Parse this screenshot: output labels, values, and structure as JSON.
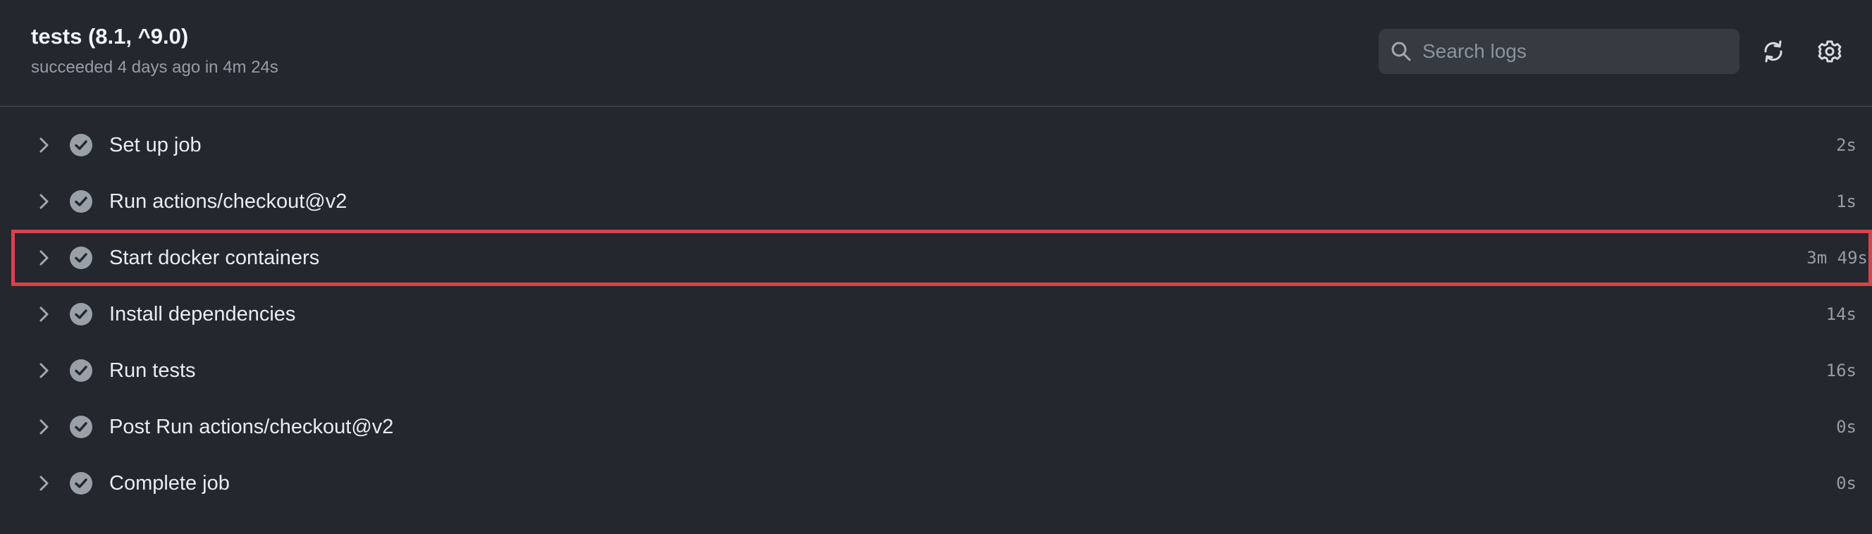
{
  "header": {
    "title": "tests (8.1, ^9.0)",
    "subtitle": "succeeded 4 days ago in 4m 24s",
    "search": {
      "placeholder": "Search logs",
      "icon": "search-icon"
    },
    "actions": [
      {
        "icon": "refresh-icon"
      },
      {
        "icon": "gear-icon"
      }
    ]
  },
  "steps": [
    {
      "name": "Set up job",
      "duration": "2s",
      "status": "success"
    },
    {
      "name": "Run actions/checkout@v2",
      "duration": "1s",
      "status": "success"
    },
    {
      "name": "Start docker containers",
      "duration": "3m 49s",
      "status": "success",
      "highlighted": true
    },
    {
      "name": "Install dependencies",
      "duration": "14s",
      "status": "success"
    },
    {
      "name": "Run tests",
      "duration": "16s",
      "status": "success"
    },
    {
      "name": "Post Run actions/checkout@v2",
      "duration": "0s",
      "status": "success"
    },
    {
      "name": "Complete job",
      "duration": "0s",
      "status": "success"
    }
  ],
  "colors": {
    "background": "#24272e",
    "highlight_border": "#d9434d",
    "success_icon": "#9aa0a8",
    "muted_text": "#959da5"
  }
}
